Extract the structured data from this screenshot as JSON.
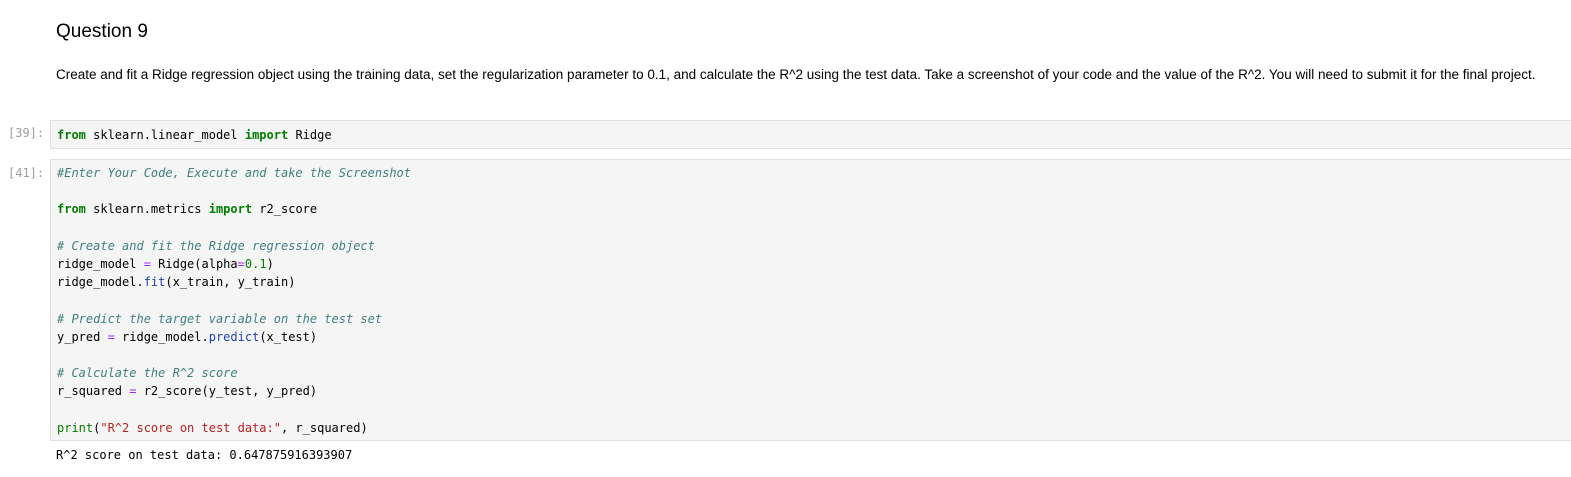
{
  "markdown": {
    "heading": "Question 9",
    "text": "Create and fit a Ridge regression object using the training data, set the regularization parameter to 0.1, and calculate the R^2 using the test data. Take a screenshot of your code and the value of the R^2. You will need to submit it for the final project."
  },
  "cell1": {
    "prompt": "[39]:",
    "kw_from": "from",
    "module": " sklearn.linear_model ",
    "kw_import": "import",
    "name": " Ridge"
  },
  "cell2": {
    "prompt": "[41]:",
    "comment_top": "#Enter Your Code, Execute and take the Screenshot",
    "import_kw_from": "from",
    "import_module": " sklearn.metrics ",
    "import_kw_import": "import",
    "import_name": " r2_score",
    "comment_fit": "# Create and fit the Ridge regression object",
    "l1_var": "ridge_model ",
    "l1_op": "=",
    "l1_call": " Ridge(alpha",
    "l1_op2": "=",
    "l1_num": "0.1",
    "l1_end": ")",
    "l2_obj": "ridge_model.",
    "l2_method": "fit",
    "l2_args": "(x_train, y_train)",
    "comment_predict": "# Predict the target variable on the test set",
    "l3_var": "y_pred ",
    "l3_op": "=",
    "l3_obj": " ridge_model.",
    "l3_method": "predict",
    "l3_args": "(x_test)",
    "comment_r2": "# Calculate the R^2 score",
    "l4_var": "r_squared ",
    "l4_op": "=",
    "l4_call": " r2_score(y_test, y_pred)",
    "l5_fn": "print",
    "l5_open": "(",
    "l5_str": "\"R^2 score on test data:\"",
    "l5_rest": ", r_squared)"
  },
  "output": "R^2 score on test data: 0.647875916393907"
}
